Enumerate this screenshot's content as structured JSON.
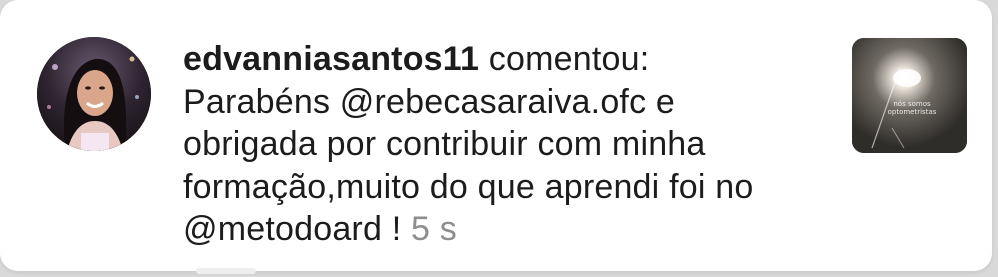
{
  "notification": {
    "username": "edvanniasantos11",
    "action": "comentou:",
    "comment_line1": "Parabéns @rebecasaraiva.ofc e",
    "comment_line2": "obrigada por contribuir com minha",
    "comment_line3": "formação,muito do que aprendi foi no",
    "comment_line4": "@metodoard !",
    "time": "5 s"
  },
  "thumbnail": {
    "caption": "nós somos optometristas"
  },
  "colors": {
    "background": "#ffffff",
    "text": "#1c1c1c",
    "timestamp": "#8e8e8e"
  }
}
